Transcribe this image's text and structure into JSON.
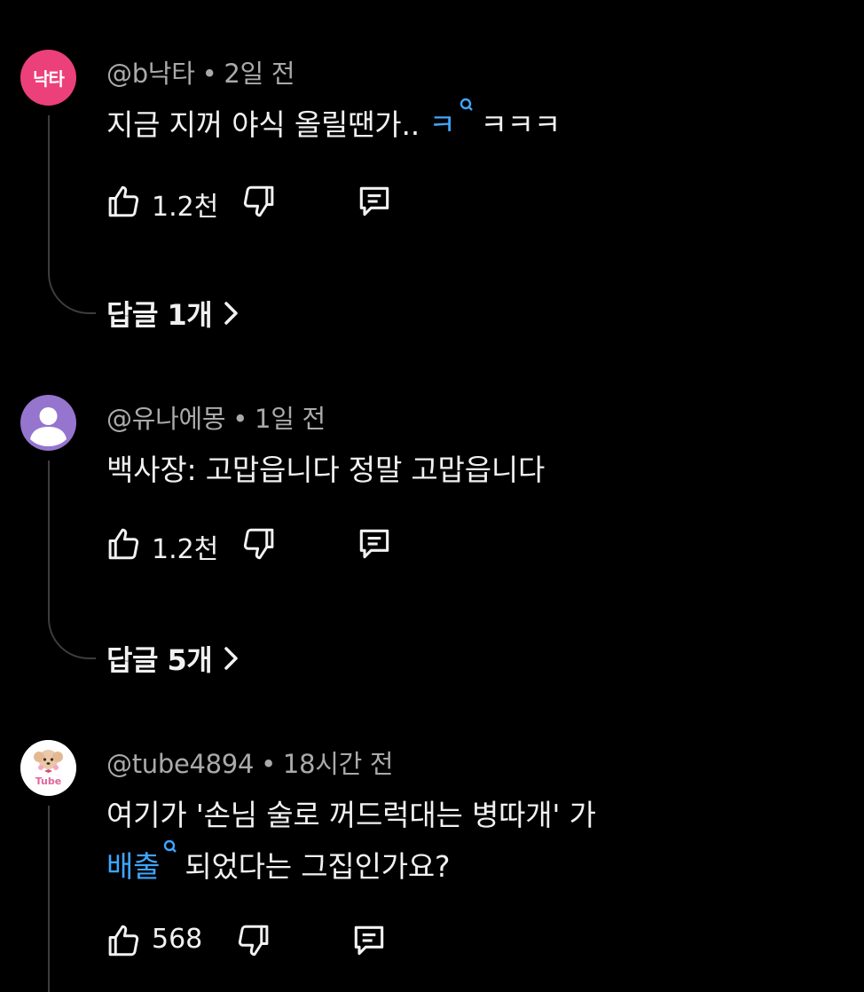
{
  "comments": [
    {
      "author": "@b낙타",
      "time": "2일 전",
      "avatar_text": "낙타",
      "avatar_color": "#ec407a",
      "text_before": "지금 지꺼 야식 올릴땐가.. ",
      "text_link": "ㅋ",
      "text_after": "ㅋㅋㅋ",
      "likes": "1.2천",
      "replies": "답글 1개"
    },
    {
      "author": "@유나에몽",
      "time": "1일 전",
      "avatar_color": "#9575cd",
      "text": "백사장: 고맙읍니다 정말 고맙읍니다",
      "likes": "1.2천",
      "replies": "답글 5개"
    },
    {
      "author": "@tube4894",
      "time": "18시간 전",
      "avatar_caption": "Tube",
      "text_line1": "여기가 '손님 술로 꺼드럭대는 병따개' 가",
      "text_line2_link": "배출",
      "text_line2_rest": "되었다는 그집인가요?",
      "likes": "568"
    }
  ],
  "colors": {
    "background": "#000000",
    "text": "#f1f1f1",
    "meta": "#aaaaaa",
    "link": "#3ea6ff",
    "thread": "#3d3d3d"
  },
  "icons": [
    "like-icon",
    "dislike-icon",
    "reply-icon",
    "chevron-right-icon",
    "search-icon"
  ]
}
